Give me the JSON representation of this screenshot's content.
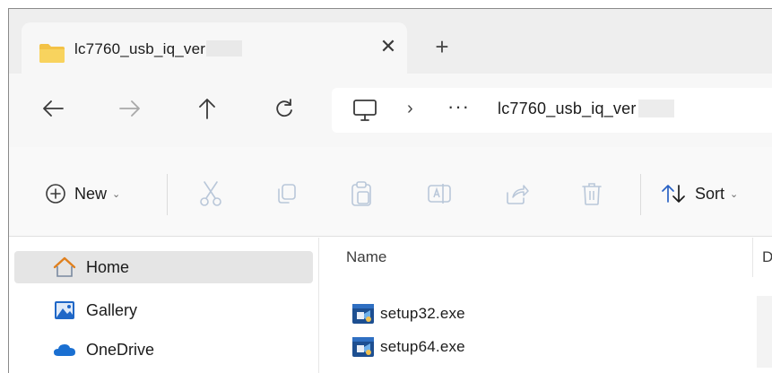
{
  "tab": {
    "title": "lc7760_usb_iq_ver",
    "close_glyph": "✕",
    "new_tab_glyph": "+"
  },
  "nav": {
    "back_icon": "back-arrow-icon",
    "forward_icon": "forward-arrow-icon",
    "up_icon": "up-arrow-icon",
    "refresh_icon": "refresh-icon"
  },
  "address": {
    "separator": "›",
    "overflow": "···",
    "path": "lc7760_usb_iq_ver"
  },
  "toolbar": {
    "new_label": "New",
    "new_caret": "⌄",
    "sort_label": "Sort",
    "sort_caret": "⌄"
  },
  "sidebar": {
    "items": [
      {
        "label": "Home",
        "icon": "home-icon",
        "selected": true
      },
      {
        "label": "Gallery",
        "icon": "gallery-icon",
        "selected": false
      },
      {
        "label": "OneDrive",
        "icon": "onedrive-cloud-icon",
        "selected": false
      }
    ]
  },
  "content": {
    "columns": [
      {
        "label": "Name"
      },
      {
        "label": "D"
      }
    ],
    "files": [
      {
        "name": "setup32.exe",
        "icon": "installer-exe-icon"
      },
      {
        "name": "setup64.exe",
        "icon": "installer-exe-icon"
      }
    ]
  },
  "colors": {
    "selected_bg": "#e5e5e5",
    "folder_yellow": "#f3c246",
    "cloud_blue": "#1a6fd1",
    "home_orange": "#e0801e"
  }
}
